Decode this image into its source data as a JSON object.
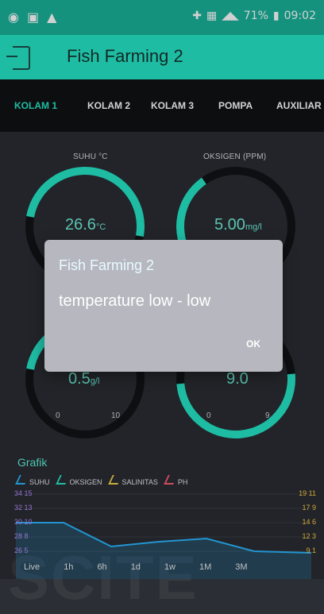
{
  "status": {
    "time": "09:02",
    "battery": "71%"
  },
  "appbar": {
    "title": "Fish Farming 2"
  },
  "tabs": [
    {
      "label": "KOLAM 1",
      "active": true
    },
    {
      "label": "KOLAM 2"
    },
    {
      "label": "KOLAM 3"
    },
    {
      "label": "POMPA"
    },
    {
      "label": "AUXILIAR"
    }
  ],
  "gauges": [
    {
      "id": "suhu",
      "title": "SUHU °C",
      "value": "26.6",
      "unit": "°C",
      "color": "#26e6c8",
      "min": "0",
      "max": "10",
      "level": 0.72
    },
    {
      "id": "oksigen",
      "title": "OKSIGEN (PPM)",
      "value": "5.00",
      "unit": "mg/l",
      "color": "#26e6c8",
      "min": "0",
      "max": "9",
      "level": 0.55
    },
    {
      "id": "salinitas",
      "title": "",
      "value": "0.5",
      "unit": "g/l",
      "color": "#26e6c8",
      "min": "0",
      "max": "10",
      "level": 0.35
    },
    {
      "id": "ph",
      "title": "",
      "value": "9.0",
      "unit": "",
      "color": "#26e6c8",
      "min": "0",
      "max": "9",
      "level": 0.62
    }
  ],
  "dialog": {
    "title": "Fish Farming 2",
    "message": "temperature low - low",
    "ok": "OK"
  },
  "chart": {
    "title": "Grafik",
    "legend": [
      {
        "name": "SUHU",
        "color": "#2bb6ff"
      },
      {
        "name": "OKSIGEN",
        "color": "#26e6c8"
      },
      {
        "name": "SALINITAS",
        "color": "#f3d34a"
      },
      {
        "name": "PH",
        "color": "#ff5d74"
      }
    ],
    "left_ticks": [
      "34 15",
      "32 13",
      "30 10",
      "28 8",
      "26 5"
    ],
    "right_ticks": [
      "19 11",
      "17 9",
      "14 6",
      "12 3",
      "9 1"
    ],
    "range": [
      "Live",
      "1h",
      "6h",
      "1d",
      "1w",
      "1M",
      "3M"
    ]
  },
  "watermark": "SCITE",
  "colors": {
    "accent": "#26e6c8",
    "status": "#1ab39a",
    "background": "#2a2d33"
  }
}
